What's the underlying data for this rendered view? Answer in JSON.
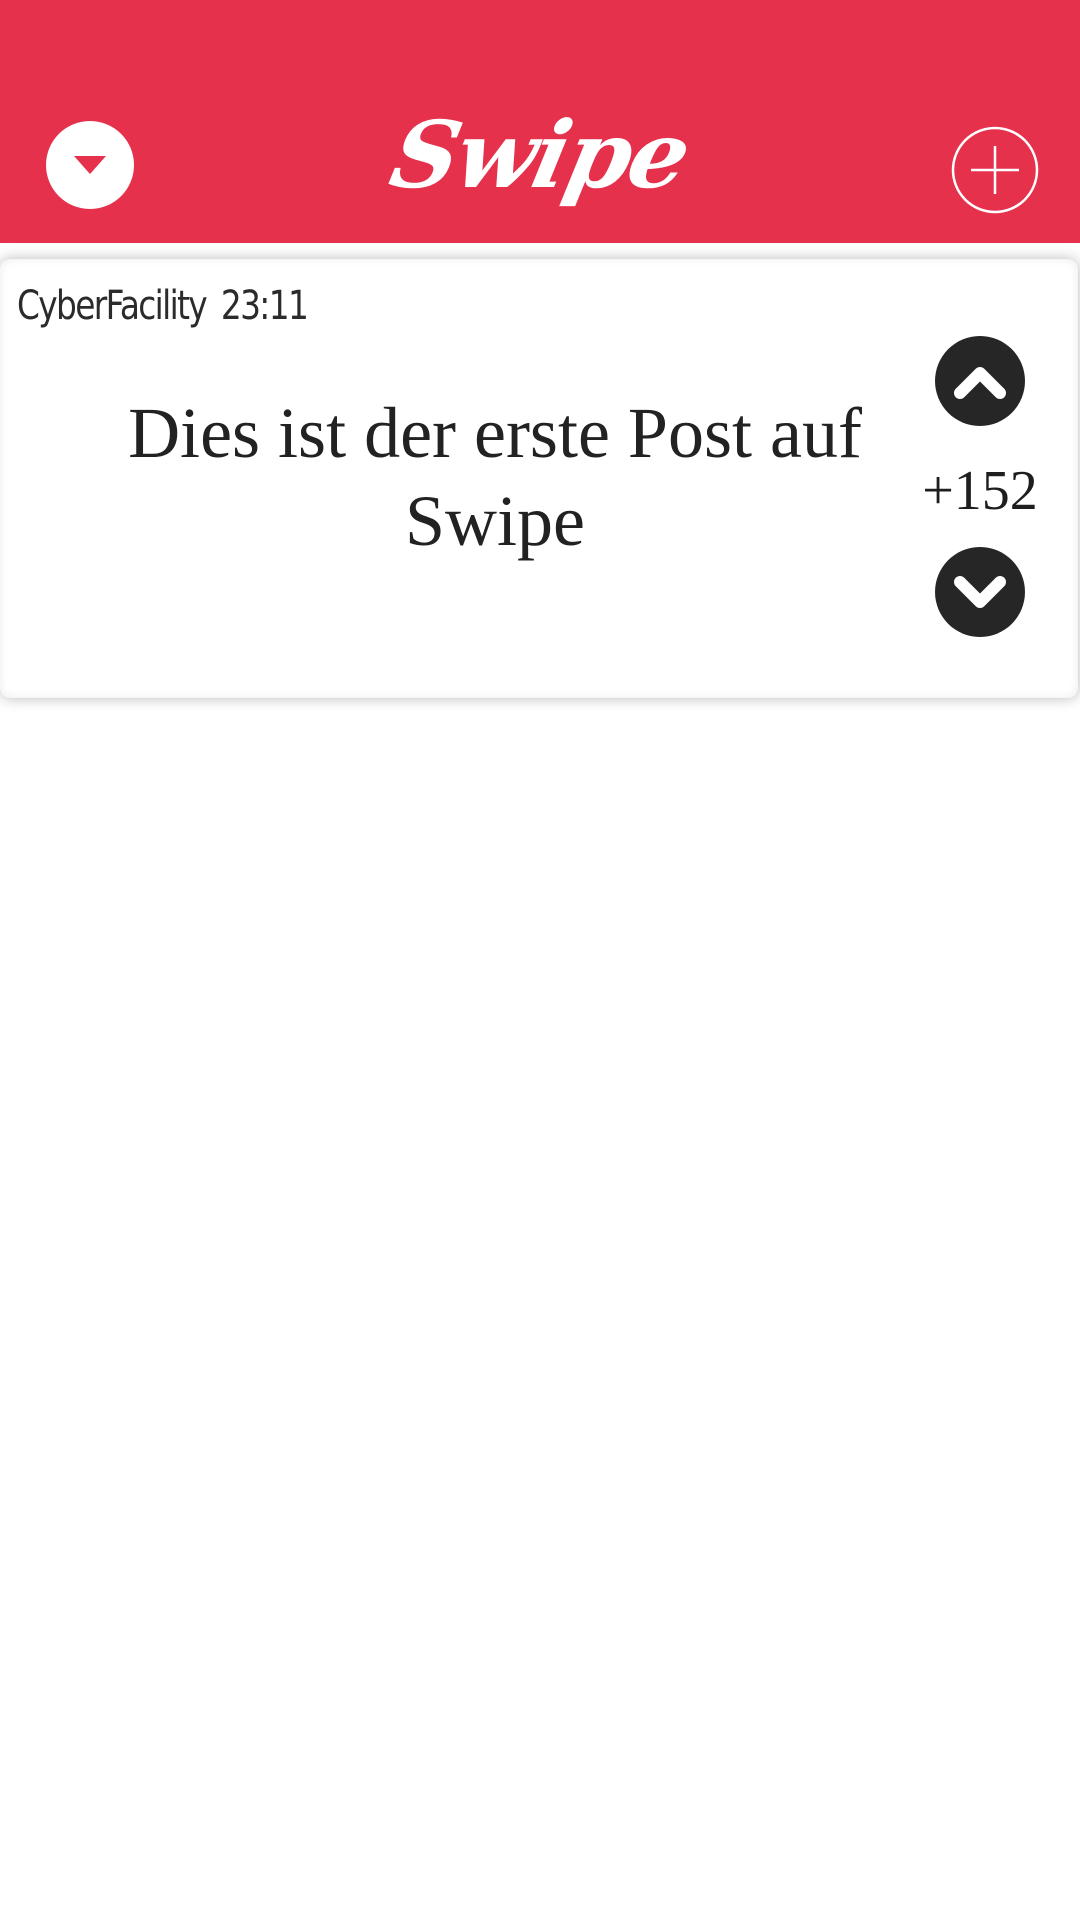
{
  "header": {
    "app_title": "Swipe",
    "background_color": "#e5314c",
    "menu_icon": "chevron-down-icon",
    "add_icon": "plus-icon"
  },
  "post": {
    "author": "CyberFacility",
    "time": "23:11",
    "text": "Dies ist der erste Post auf Swipe",
    "score": "+152",
    "upvote_icon": "chevron-up-icon",
    "downvote_icon": "chevron-down-icon"
  }
}
